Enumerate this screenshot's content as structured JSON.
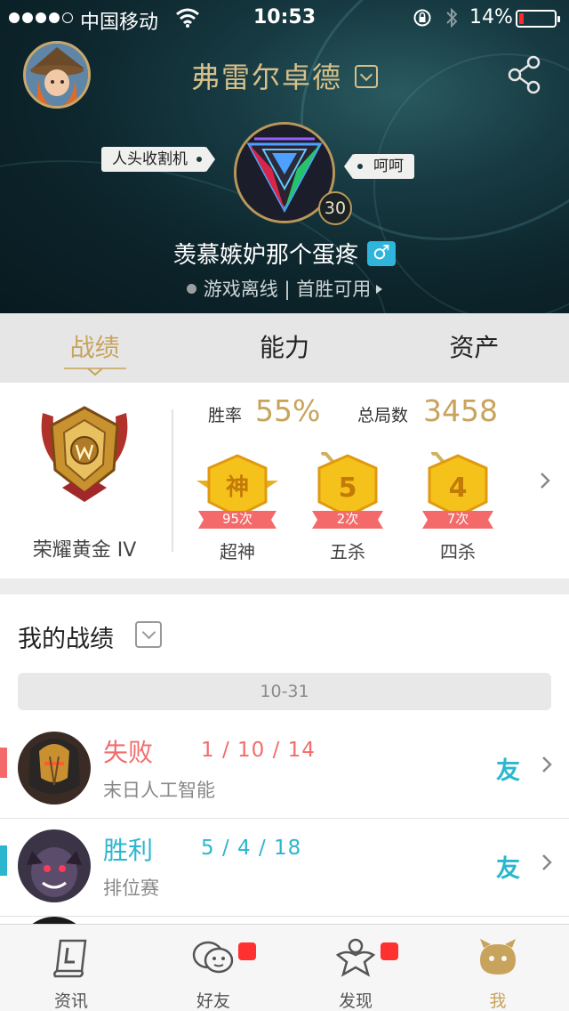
{
  "status_bar": {
    "carrier": "中国移动",
    "time": "10:53",
    "battery_percent_text": "14%",
    "battery_level": 0.14
  },
  "header": {
    "hero_name": "弗雷尔卓德",
    "left_tag": "人头收割机",
    "right_tag": "呵呵",
    "level": "30",
    "nickname": "羡慕嫉妒那个蛋疼",
    "gender_symbol": "♂",
    "online_status": "游戏离线",
    "separator": "|",
    "first_win": "首胜可用"
  },
  "tabs": [
    {
      "label": "战绩",
      "active": true
    },
    {
      "label": "能力",
      "active": false
    },
    {
      "label": "资产",
      "active": false
    }
  ],
  "stats": {
    "rank_name": "荣耀黄金 IV",
    "win_rate_label": "胜率",
    "win_rate_value": "55%",
    "total_games_label": "总局数",
    "total_games_value": "3458",
    "medals": [
      {
        "glyph": "神",
        "count": "95次",
        "label": "超神"
      },
      {
        "glyph": "5",
        "count": "2次",
        "label": "五杀"
      },
      {
        "glyph": "4",
        "count": "7次",
        "label": "四杀"
      }
    ]
  },
  "records": {
    "title": "我的战绩",
    "date": "10-31",
    "rows": [
      {
        "result": "失败",
        "kda": "1 / 10 / 14",
        "mode": "末日人工智能",
        "friend": "友",
        "color": "#f26c6c"
      },
      {
        "result": "胜利",
        "kda": "5 / 4 / 18",
        "mode": "排位赛",
        "friend": "友",
        "color": "#2bb6cf"
      }
    ]
  },
  "nav": [
    {
      "label": "资讯",
      "icon": "news-icon",
      "active": false,
      "badge": false
    },
    {
      "label": "好友",
      "icon": "friends-icon",
      "active": false,
      "badge": true
    },
    {
      "label": "发现",
      "icon": "discover-icon",
      "active": false,
      "badge": true
    },
    {
      "label": "我",
      "icon": "me-icon",
      "active": true,
      "badge": false
    }
  ],
  "colors": {
    "gold": "#c8a35c",
    "loss": "#f26c6c",
    "win": "#2bb6cf",
    "badge_red": "#ff3030"
  }
}
